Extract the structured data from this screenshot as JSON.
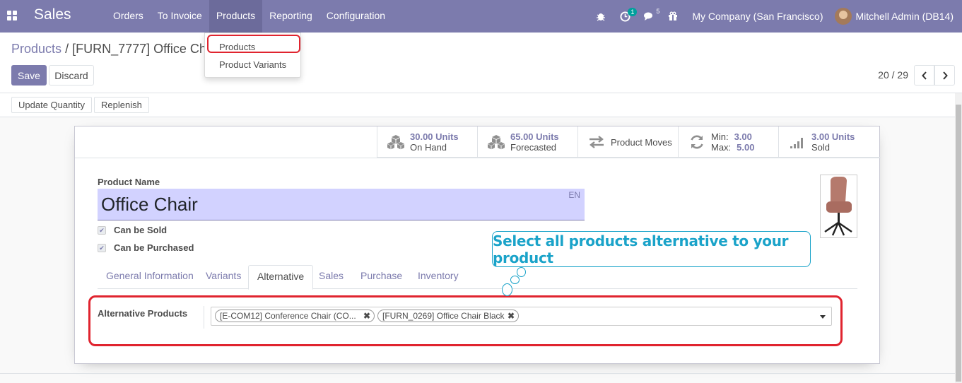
{
  "navbar": {
    "app_name": "Sales",
    "menu": [
      "Orders",
      "To Invoice",
      "Products",
      "Reporting",
      "Configuration"
    ],
    "activity_count": "1",
    "messages_count": "5",
    "company": "My Company (San Francisco)",
    "user": "Mitchell Admin (DB14)"
  },
  "dropdown": {
    "items": [
      "Products",
      "Product Variants"
    ]
  },
  "control_panel": {
    "breadcrumb_parent": "Products",
    "breadcrumb_separator": "/",
    "breadcrumb_current": "[FURN_7777] Office Ch",
    "save_label": "Save",
    "discard_label": "Discard",
    "pager": "20 / 29"
  },
  "statusbar": {
    "update_quantity": "Update Quantity",
    "replenish": "Replenish"
  },
  "stats": {
    "on_hand_value": "30.00 Units",
    "on_hand_label": "On Hand",
    "forecasted_value": "65.00 Units",
    "forecasted_label": "Forecasted",
    "moves_label": "Product Moves",
    "min_label": "Min:",
    "min_value": "3.00",
    "max_label": "Max:",
    "max_value": "5.00",
    "sold_value": "3.00 Units",
    "sold_label": "Sold"
  },
  "form": {
    "product_name_label": "Product Name",
    "product_name": "Office Chair",
    "lang": "EN",
    "can_be_sold": "Can be Sold",
    "can_be_purchased": "Can be Purchased"
  },
  "tabs": [
    "General Information",
    "Variants",
    "Alternative",
    "Sales",
    "Purchase",
    "Inventory"
  ],
  "alternative": {
    "label": "Alternative Products",
    "tags": [
      "[E-COM12] Conference Chair (CO...",
      "[FURN_0269] Office Chair Black"
    ]
  },
  "callout": {
    "text": "Select all products alternative to your product"
  },
  "colors": {
    "navbar": "#7c7bad",
    "accent": "#7c7bad",
    "highlight": "#e0242f",
    "callout": "#1aa3c9"
  }
}
